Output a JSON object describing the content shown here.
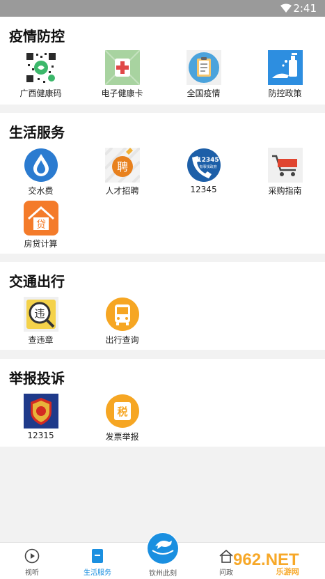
{
  "status": {
    "time": "2:41"
  },
  "sections": {
    "epidemic": {
      "title": "疫情防控",
      "items": [
        "广西健康码",
        "电子健康卡",
        "全国疫情",
        "防控政策"
      ]
    },
    "life": {
      "title": "生活服务",
      "items": [
        "交水费",
        "人才招聘",
        "12345",
        "采购指南",
        "房贷计算"
      ]
    },
    "transport": {
      "title": "交通出行",
      "items": [
        "查违章",
        "出行查询"
      ]
    },
    "report": {
      "title": "举报投诉",
      "items": [
        "12315",
        "发票举报"
      ]
    }
  },
  "icon_text": {
    "hotline": "12345",
    "hotline_sub": "有事找政府",
    "recruit": "聘",
    "loan": "贷",
    "violation": "违",
    "tax": "税"
  },
  "bottom_nav": {
    "items": [
      "视听",
      "生活服务",
      "钦州此刻",
      "问政"
    ],
    "active": "生活服务"
  },
  "watermark": {
    "main": "962.NET",
    "sub": "乐游网"
  },
  "colors": {
    "accent": "#1a8fe0",
    "orange": "#f6a623",
    "statusbar": "#9a9a9a"
  }
}
